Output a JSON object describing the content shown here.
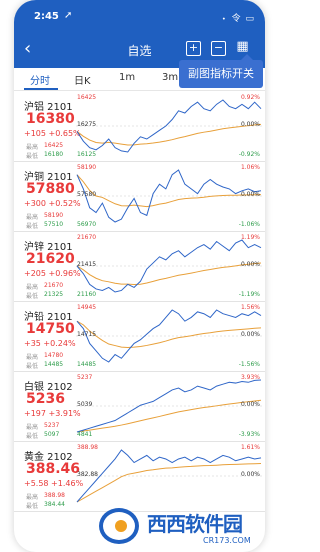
{
  "status": {
    "time": "2:45",
    "icons": "᭼ 令 ▭"
  },
  "nav": {
    "back": "‹",
    "title": "自选",
    "tooltip": "副图指标开关"
  },
  "tabs": [
    {
      "label": "分时",
      "active": true
    },
    {
      "label": "日K",
      "active": false
    },
    {
      "label": "1m",
      "active": false
    },
    {
      "label": "3m",
      "active": false
    }
  ],
  "hl_labels": {
    "high": "最高",
    "low": "最低"
  },
  "colors": {
    "up": "#e83a3a",
    "down": "#2d9c4a",
    "accent": "#1f5fc0",
    "avg_line": "#e8a03a",
    "price_line": "#2f66c8"
  },
  "rows": [
    {
      "name": "沪铝 2101",
      "price": "16380",
      "change": "+105 +0.65%",
      "high": "16425",
      "low": "16180",
      "chart": {
        "top": "16425",
        "mid": "16275",
        "bot": "16125",
        "top_pct": "0.92%",
        "mid_pct": "0.00%",
        "bot_pct": "-0.92%"
      },
      "series": [
        16275,
        16230,
        16200,
        16190,
        16210,
        16240,
        16200,
        16185,
        16180,
        16220,
        16250,
        16240,
        16260,
        16280,
        16300,
        16330,
        16370,
        16360,
        16390,
        16410,
        16380,
        16370,
        16400,
        16420,
        16390,
        16380,
        16400,
        16380,
        16410,
        16380
      ]
    },
    {
      "name": "沪铜 2101",
      "price": "57880",
      "change": "+300 +0.52%",
      "high": "58190",
      "low": "57510",
      "chart": {
        "top": "58190",
        "mid": "57580",
        "bot": "56970",
        "top_pct": "1.06%",
        "mid_pct": "0.00%",
        "bot_pct": "-1.06%"
      },
      "series": [
        58050,
        57900,
        57700,
        57650,
        57750,
        57600,
        57550,
        57580,
        57700,
        57800,
        57650,
        57620,
        57850,
        57950,
        57900,
        58050,
        58100,
        57950,
        57900,
        57850,
        57950,
        58000,
        57950,
        57920,
        57900,
        57850,
        57880,
        57900,
        57870,
        57880
      ]
    },
    {
      "name": "沪锌 2101",
      "price": "21620",
      "change": "+205 +0.96%",
      "high": "21670",
      "low": "21325",
      "chart": {
        "top": "21670",
        "mid": "21415",
        "bot": "21160",
        "top_pct": "1.19%",
        "mid_pct": "0.00%",
        "bot_pct": "-1.19%"
      },
      "series": [
        21500,
        21450,
        21380,
        21350,
        21340,
        21360,
        21330,
        21340,
        21380,
        21360,
        21400,
        21480,
        21520,
        21560,
        21540,
        21580,
        21600,
        21560,
        21590,
        21620,
        21640,
        21610,
        21660,
        21630,
        21600,
        21650,
        21670,
        21620,
        21640,
        21620
      ]
    },
    {
      "name": "沪铅 2101",
      "price": "14750",
      "change": "+35 +0.24%",
      "high": "14780",
      "low": "14485",
      "chart": {
        "top": "14945",
        "mid": "14715",
        "bot": "14485",
        "top_pct": "1.56%",
        "mid_pct": "0.00%",
        "bot_pct": "-1.56%"
      },
      "series": [
        14720,
        14680,
        14600,
        14560,
        14520,
        14500,
        14540,
        14520,
        14560,
        14600,
        14620,
        14650,
        14680,
        14700,
        14740,
        14780,
        14760,
        14720,
        14740,
        14770,
        14760,
        14740,
        14780,
        14760,
        14750,
        14740,
        14760,
        14750,
        14770,
        14750
      ]
    },
    {
      "name": "白银 2102",
      "price": "5236",
      "change": "+197 +3.91%",
      "high": "5237",
      "low": "5097",
      "chart": {
        "top": "5237",
        "mid": "5039",
        "bot": "4841",
        "top_pct": "3.93%",
        "mid_pct": "0.00%",
        "bot_pct": "-3.93%"
      },
      "series": [
        5100,
        5105,
        5110,
        5115,
        5120,
        5125,
        5130,
        5140,
        5150,
        5160,
        5170,
        5175,
        5180,
        5190,
        5200,
        5210,
        5215,
        5205,
        5210,
        5220,
        5215,
        5210,
        5220,
        5225,
        5230,
        5228,
        5232,
        5230,
        5235,
        5236
      ]
    },
    {
      "name": "黄金 2102",
      "price": "388.46",
      "change": "+5.58 +1.46%",
      "high": "388.98",
      "low": "384.44",
      "chart": {
        "top": "388.98",
        "mid": "382.88",
        "bot": "",
        "top_pct": "1.61%",
        "mid_pct": "0.00%",
        "bot_pct": ""
      },
      "series": [
        386.0,
        386.4,
        386.8,
        387.2,
        387.6,
        388.0,
        388.4,
        388.9,
        388.6,
        388.2,
        388.4,
        388.6,
        388.3,
        388.5,
        388.4,
        388.2,
        388.4,
        388.5,
        388.3,
        388.5,
        388.4,
        388.2,
        388.4,
        388.6,
        388.5,
        388.3,
        388.4,
        388.5,
        388.4,
        388.46
      ]
    }
  ],
  "watermark": {
    "brand": "西西软件园",
    "url": "CR173.COM"
  }
}
